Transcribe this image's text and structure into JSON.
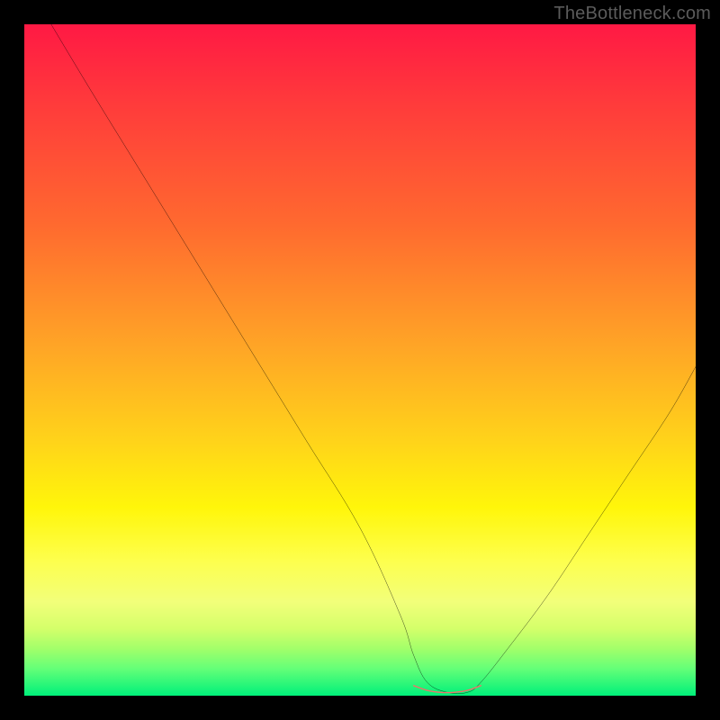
{
  "watermark": "TheBottleneck.com",
  "chart_data": {
    "type": "line",
    "title": "",
    "xlabel": "",
    "ylabel": "",
    "xlim": [
      0,
      100
    ],
    "ylim": [
      0,
      100
    ],
    "grid": false,
    "legend": false,
    "series": [
      {
        "name": "bottleneck-curve",
        "x": [
          4,
          10,
          18,
          26,
          34,
          42,
          50,
          56,
          58,
          60,
          63,
          66,
          68,
          72,
          78,
          84,
          90,
          96,
          100
        ],
        "values": [
          100,
          90,
          77,
          64,
          51,
          38,
          25,
          12,
          6,
          2,
          0.5,
          0.5,
          2,
          7,
          15,
          24,
          33,
          42,
          49
        ]
      },
      {
        "name": "sweet-spot-marker",
        "x": [
          58,
          60,
          62,
          64,
          66,
          68
        ],
        "values": [
          1.5,
          0.8,
          0.5,
          0.5,
          0.8,
          1.5
        ]
      }
    ],
    "gradient_stops": [
      {
        "pos": 0,
        "color": "#ff1944"
      },
      {
        "pos": 50,
        "color": "#ffc81e"
      },
      {
        "pos": 80,
        "color": "#fdff4e"
      },
      {
        "pos": 100,
        "color": "#00f07a"
      }
    ]
  }
}
